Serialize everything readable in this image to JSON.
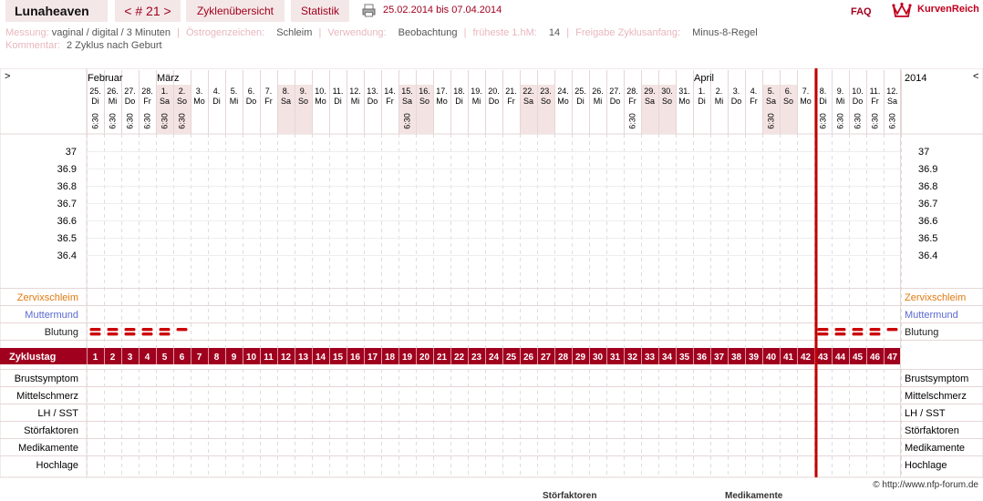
{
  "header": {
    "user": "Lunaheaven",
    "cycle_nav": "< # 21 >",
    "tabs": [
      "Zyklenübersicht",
      "Statistik"
    ],
    "date_range": "25.02.2014 bis 07.04.2014",
    "faq": "FAQ",
    "brand": "KurvenReich",
    "icons": {
      "print": "printer-icon",
      "brand": "crown-icon"
    }
  },
  "info": {
    "messung_label": "Messung:",
    "messung": "vaginal / digital / 3 Minuten",
    "oestrogen_label": "Östrogenzeichen:",
    "oestrogen": "Schleim",
    "verwendung_label": "Verwendung:",
    "verwendung": "Beobachtung",
    "hm_label": "früheste 1.hM:",
    "hm": "14",
    "freigabe_label": "Freigabe Zyklusanfang:",
    "freigabe": "Minus-8-Regel",
    "kommentar_label": "Kommentar:",
    "kommentar": "2 Zyklus nach Geburt"
  },
  "chart_data": {
    "type": "table",
    "nav_left": ">",
    "nav_right": "<",
    "year": "2014",
    "months": [
      {
        "name": "Februar",
        "day_index": 0
      },
      {
        "name": "März",
        "day_index": 4
      },
      {
        "name": "April",
        "day_index": 35
      }
    ],
    "days": [
      {
        "d": "25.",
        "w": "Di",
        "t": "6:30"
      },
      {
        "d": "26.",
        "w": "Mi",
        "t": "6:30"
      },
      {
        "d": "27.",
        "w": "Do",
        "t": "6:30"
      },
      {
        "d": "28.",
        "w": "Fr",
        "t": "6:30"
      },
      {
        "d": "1.",
        "w": "Sa",
        "t": "6:30",
        "we": true
      },
      {
        "d": "2.",
        "w": "So",
        "t": "6:30",
        "we": true
      },
      {
        "d": "3.",
        "w": "Mo",
        "t": ""
      },
      {
        "d": "4.",
        "w": "Di",
        "t": ""
      },
      {
        "d": "5.",
        "w": "Mi",
        "t": ""
      },
      {
        "d": "6.",
        "w": "Do",
        "t": ""
      },
      {
        "d": "7.",
        "w": "Fr",
        "t": ""
      },
      {
        "d": "8.",
        "w": "Sa",
        "t": "",
        "we": true
      },
      {
        "d": "9.",
        "w": "So",
        "t": "",
        "we": true
      },
      {
        "d": "10.",
        "w": "Mo",
        "t": ""
      },
      {
        "d": "11.",
        "w": "Di",
        "t": ""
      },
      {
        "d": "12.",
        "w": "Mi",
        "t": ""
      },
      {
        "d": "13.",
        "w": "Do",
        "t": ""
      },
      {
        "d": "14.",
        "w": "Fr",
        "t": ""
      },
      {
        "d": "15.",
        "w": "Sa",
        "t": "6:30",
        "we": true
      },
      {
        "d": "16.",
        "w": "So",
        "t": "",
        "we": true
      },
      {
        "d": "17.",
        "w": "Mo",
        "t": ""
      },
      {
        "d": "18.",
        "w": "Di",
        "t": ""
      },
      {
        "d": "19.",
        "w": "Mi",
        "t": ""
      },
      {
        "d": "20.",
        "w": "Do",
        "t": ""
      },
      {
        "d": "21.",
        "w": "Fr",
        "t": ""
      },
      {
        "d": "22.",
        "w": "Sa",
        "t": "",
        "we": true
      },
      {
        "d": "23.",
        "w": "So",
        "t": "",
        "we": true
      },
      {
        "d": "24.",
        "w": "Mo",
        "t": ""
      },
      {
        "d": "25.",
        "w": "Di",
        "t": ""
      },
      {
        "d": "26.",
        "w": "Mi",
        "t": ""
      },
      {
        "d": "27.",
        "w": "Do",
        "t": ""
      },
      {
        "d": "28.",
        "w": "Fr",
        "t": "6:30"
      },
      {
        "d": "29.",
        "w": "Sa",
        "t": "",
        "we": true
      },
      {
        "d": "30.",
        "w": "So",
        "t": "",
        "we": true
      },
      {
        "d": "31.",
        "w": "Mo",
        "t": ""
      },
      {
        "d": "1.",
        "w": "Di",
        "t": ""
      },
      {
        "d": "2.",
        "w": "Mi",
        "t": ""
      },
      {
        "d": "3.",
        "w": "Do",
        "t": ""
      },
      {
        "d": "4.",
        "w": "Fr",
        "t": ""
      },
      {
        "d": "5.",
        "w": "Sa",
        "t": "6:30",
        "we": true
      },
      {
        "d": "6.",
        "w": "So",
        "t": "",
        "we": true
      },
      {
        "d": "7.",
        "w": "Mo",
        "t": ""
      }
    ],
    "next_days": [
      {
        "d": "8.",
        "w": "Di",
        "t": "6:30"
      },
      {
        "d": "9.",
        "w": "Mi",
        "t": "6:30"
      },
      {
        "d": "10.",
        "w": "Do",
        "t": "6:30"
      },
      {
        "d": "11.",
        "w": "Fr",
        "t": "6:30"
      },
      {
        "d": "12.",
        "w": "Sa",
        "t": "6:30"
      }
    ],
    "temp_ticks": [
      "37",
      "36.9",
      "36.8",
      "36.7",
      "36.6",
      "36.5",
      "36.4"
    ],
    "obs_rows": [
      "Zervixschleim",
      "Muttermund",
      "Blutung"
    ],
    "obs_colors": {
      "Zervixschleim": "#e07a10",
      "Muttermund": "#5a6ad0",
      "Blutung": "#222222"
    },
    "blutung_cycle_days": [
      1,
      2,
      3,
      4,
      5,
      6
    ],
    "blutung_next_days": [
      43,
      44,
      45,
      46,
      47
    ],
    "blutung_strength": {
      "1": "strong",
      "2": "strong",
      "3": "medium",
      "4": "medium",
      "5": "medium",
      "6": "light",
      "43": "medium",
      "44": "strong",
      "45": "strong",
      "46": "medium",
      "47": "light"
    },
    "zyklustag_label": "Zyklustag",
    "cycle_days": [
      1,
      2,
      3,
      4,
      5,
      6,
      7,
      8,
      9,
      10,
      11,
      12,
      13,
      14,
      15,
      16,
      17,
      18,
      19,
      20,
      21,
      22,
      23,
      24,
      25,
      26,
      27,
      28,
      29,
      30,
      31,
      32,
      33,
      34,
      35,
      36,
      37,
      38,
      39,
      40,
      41,
      42
    ],
    "next_cycle_days": [
      43,
      44,
      45,
      46,
      47
    ],
    "bottom_rows": [
      "Brustsymptom",
      "Mittelschmerz",
      "LH / SST",
      "Störfaktoren",
      "Medikamente",
      "Hochlage"
    ],
    "colors": {
      "accent": "#a0001e",
      "weekend": "#f4e3e3",
      "cycle_end": "#c00000",
      "zyklustag_bg": "#a0001e",
      "blood": "#cc0000"
    }
  },
  "footer": {
    "copyright": "© http://www.nfp-forum.de",
    "cut_left": "Störfaktoren",
    "cut_right": "Medikamente"
  }
}
